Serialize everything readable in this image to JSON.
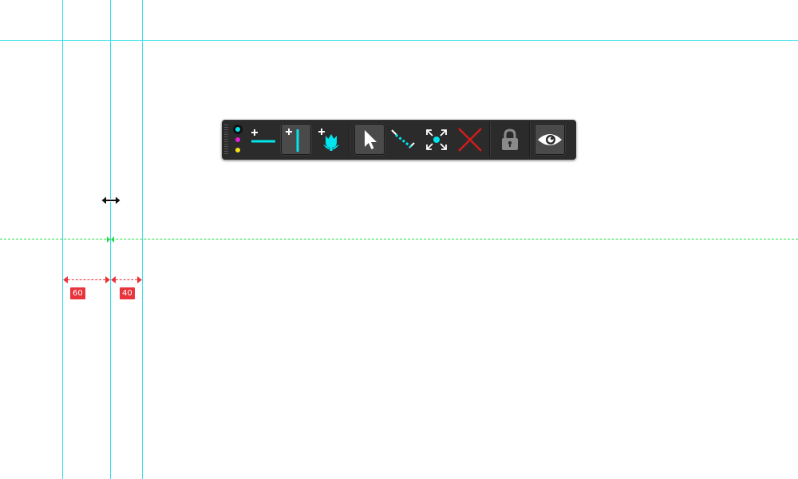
{
  "canvas": {
    "background": "#ffffff",
    "guide_color": "#33e0ea",
    "new_guide_color": "#22dd44",
    "measure_color": "#e8343b"
  },
  "measurements": [
    {
      "label": "60"
    },
    {
      "label": "40"
    }
  ],
  "cursor": {
    "icon": "horizontal-resize-cursor-icon"
  },
  "toolbar": {
    "background": "#2b2b2b",
    "accent": "#00e5ee",
    "colors": [
      "#00e5ee",
      "#e91fd6",
      "#f4e21a"
    ],
    "selected_color": "#00e5ee",
    "tools": [
      {
        "name": "add-horizontal-guide",
        "icon": "add-horizontal-guide-icon",
        "active": false
      },
      {
        "name": "add-vertical-guide",
        "icon": "add-vertical-guide-icon",
        "active": true
      },
      {
        "name": "add-tulip-guide",
        "icon": "tulip-icon",
        "active": false
      },
      {
        "name": "select",
        "icon": "pointer-arrow-icon",
        "active": true
      },
      {
        "name": "measure",
        "icon": "measure-line-icon",
        "active": false
      },
      {
        "name": "center",
        "icon": "expand-center-icon",
        "active": false
      },
      {
        "name": "delete-all",
        "icon": "red-x-icon",
        "active": false
      },
      {
        "name": "lock",
        "icon": "padlock-icon",
        "active": false
      },
      {
        "name": "visibility",
        "icon": "eye-icon",
        "active": true
      }
    ],
    "delete_color": "#d21c1c",
    "lock_color": "#8a8a8a"
  }
}
